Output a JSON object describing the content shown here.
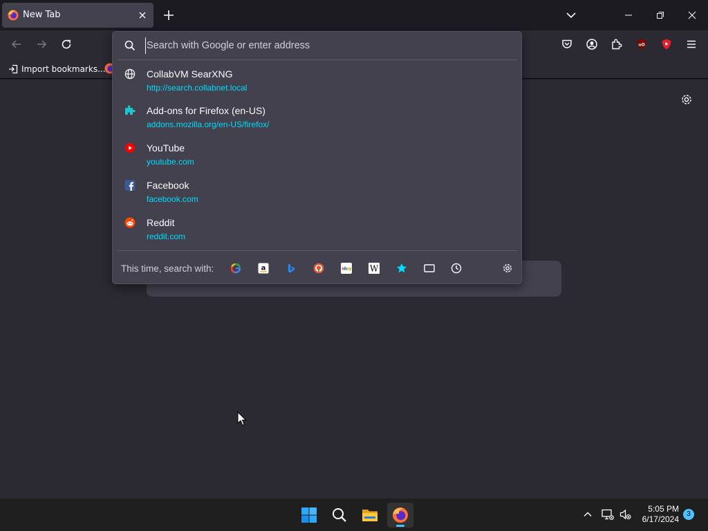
{
  "tab": {
    "title": "New Tab"
  },
  "bookmarks_bar": {
    "import_label": "Import bookmarks..."
  },
  "urlbar": {
    "placeholder": "Search with Google or enter address",
    "value": ""
  },
  "results": [
    {
      "title": "CollabVM SearXNG",
      "url": "http://search.collabnet.local",
      "icon": "globe-icon"
    },
    {
      "title": "Add-ons for Firefox (en-US)",
      "url": "addons.mozilla.org/en-US/firefox/",
      "icon": "addons-puzzle-icon"
    },
    {
      "title": "YouTube",
      "url": "youtube.com",
      "icon": "youtube-icon"
    },
    {
      "title": "Facebook",
      "url": "facebook.com",
      "icon": "facebook-icon"
    },
    {
      "title": "Reddit",
      "url": "reddit.com",
      "icon": "reddit-icon"
    }
  ],
  "search_with": {
    "label": "This time, search with:",
    "engines": [
      "google-icon",
      "amazon-icon",
      "bing-icon",
      "duckduckgo-icon",
      "ebay-icon",
      "wikipedia-icon",
      "bookmarks-star-icon",
      "tabs-icon",
      "history-icon",
      "search-settings-gear-icon"
    ]
  },
  "taskbar": {
    "time": "5:05 PM",
    "date": "6/17/2024",
    "notification_count": "3",
    "apps": [
      "windows-start-icon",
      "search-icon",
      "file-explorer-icon",
      "firefox-icon"
    ]
  },
  "colors": {
    "url_text": "#00ddff",
    "popup_bg": "#42414d",
    "toolbar_bg": "#2b2a33",
    "accent": "#4cc2ff"
  }
}
